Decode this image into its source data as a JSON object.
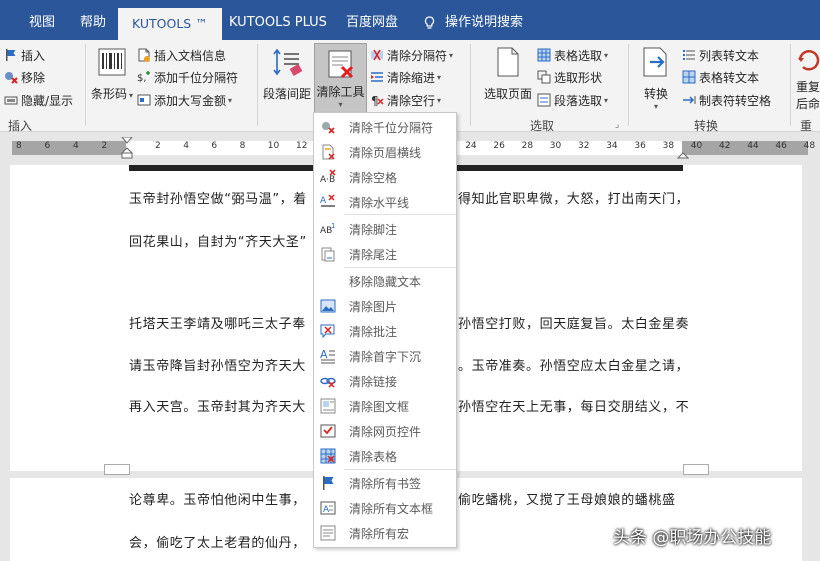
{
  "tabs": {
    "view": "视图",
    "help": "帮助",
    "kutools": "KUTOOLS ™",
    "kutools_plus": "KUTOOLS PLUS",
    "baidu": "百度网盘",
    "search": "操作说明搜索"
  },
  "ribbon": {
    "insert_group": {
      "insert": "插入",
      "remove": "移除",
      "hide_show": "隐藏/显示",
      "label": "插入"
    },
    "barcode": "条形码",
    "doc_info": {
      "insert_doc_info": "插入文档信息",
      "add_thousand_sep": "添加千位分隔符",
      "add_amount_caps": "添加大写金额"
    },
    "para_spacing": "段落间距",
    "clear_tools": "清除工具",
    "clear_group": {
      "clear_sep": "清除分隔符",
      "clear_indent": "清除缩进",
      "clear_empty_lines": "清除空行"
    },
    "select_page": "选取页面",
    "select_group": {
      "select_table": "表格选取",
      "select_shape": "选取形状",
      "select_para": "段落选取",
      "label": "选取"
    },
    "convert": "转换",
    "convert_group": {
      "list_to_text": "列表转文本",
      "table_to_text": "表格转文本",
      "tab_to_space": "制表符转空格",
      "label": "转换"
    },
    "right_partial": {
      "top": "重复",
      "mid": "后命",
      "bottom": "重复"
    }
  },
  "ruler": {
    "ticks": [
      "8",
      "6",
      "4",
      "2",
      "2",
      "4",
      "6",
      "8",
      "10",
      "12",
      "14",
      "16",
      "18",
      "20",
      "22",
      "24",
      "26",
      "28",
      "30",
      "32",
      "34",
      "36",
      "38",
      "40",
      "42",
      "44",
      "46",
      "48"
    ]
  },
  "document": {
    "lines": [
      "玉帝封孙悟空做“弼马温”，着",
      "得知此官职卑微，大怒，打出南天门，",
      "回花果山，自封为“齐天大圣”",
      "托塔天王李靖及哪吒三太子奉",
      "孙悟空打败，回天庭复旨。太白金星奏",
      "请玉帝降旨封孙悟空为齐天大",
      "。玉帝准奏。孙悟空应太白金星之请，",
      "再入天宫。玉帝封其为齐天大",
      "孙悟空在天上无事，每日交朋结义，不",
      "论尊卑。玉帝怕他闲中生事，",
      "偷吃蟠桃，又搅了王母娘娘的蟠桃盛",
      "会，偷吃了太上老君的仙丹，"
    ]
  },
  "menu": {
    "items": [
      "清除千位分隔符",
      "清除页眉横线",
      "清除空格",
      "清除水平线",
      "清除脚注",
      "清除尾注",
      "移除隐藏文本",
      "清除图片",
      "清除批注",
      "清除首字下沉",
      "清除链接",
      "清除图文框",
      "清除网页控件",
      "清除表格",
      "清除所有书签",
      "清除所有文本框",
      "清除所有宏"
    ]
  },
  "watermark": "头条 @职场办公技能"
}
